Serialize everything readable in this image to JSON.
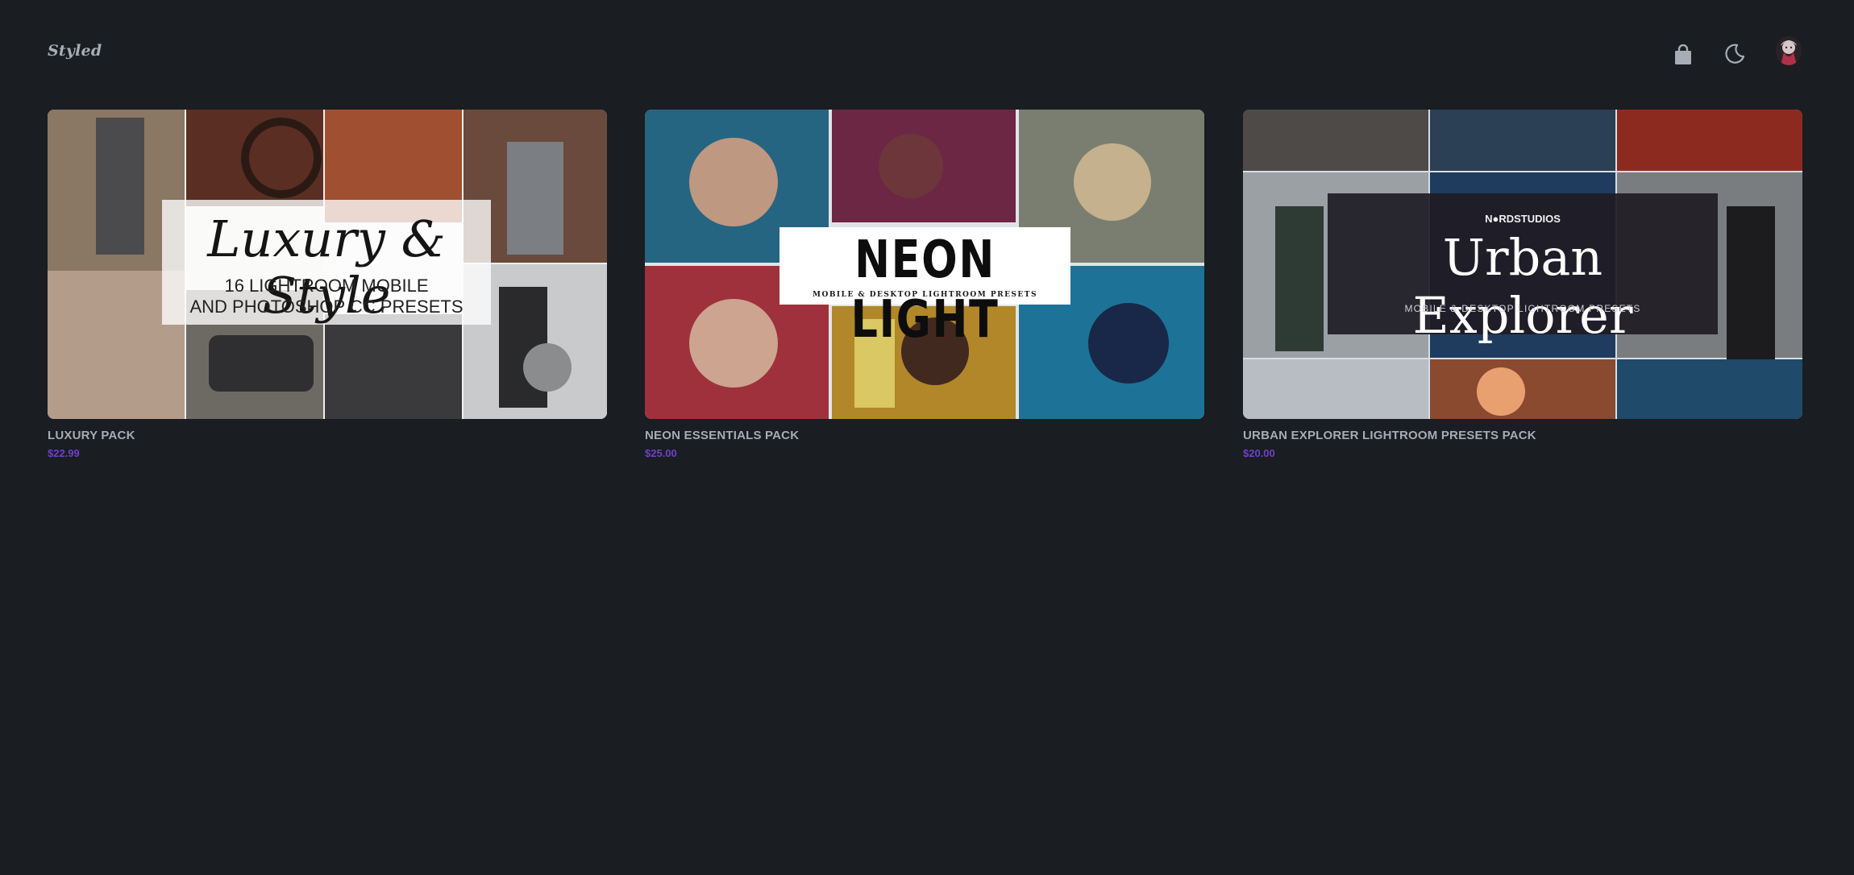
{
  "header": {
    "logo": "Styled",
    "icons": [
      "shopping-bag-icon",
      "moon-icon",
      "avatar"
    ]
  },
  "products": [
    {
      "name": "LUXURY PACK",
      "price": "$22.99",
      "cover_title": "Luxury & Style",
      "cover_line1": "16 LIGHTROOM MOBILE",
      "cover_line2": "AND PHOTOSHOP CC PRESETS"
    },
    {
      "name": "NEON ESSENTIALS PACK",
      "price": "$25.00",
      "cover_title": "NEON LIGHT",
      "cover_subtitle": "MOBILE & DESKTOP LIGHTROOM PRESETS"
    },
    {
      "name": "URBAN EXPLORER LIGHTROOM PRESETS PACK",
      "price": "$20.00",
      "cover_brand": "N●RDSTUDIOS",
      "cover_title": "Urban Explorer",
      "cover_subtitle": "MOBILE & DESKTOP LIGHTROOM PRESETS"
    }
  ],
  "colors": {
    "background": "#1a1d21",
    "product_name": "#a5acb7",
    "price": "#6f3fcf"
  }
}
